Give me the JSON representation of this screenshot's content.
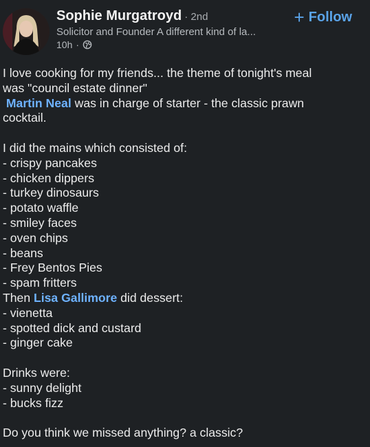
{
  "author": {
    "name": "Sophie Murgatroyd",
    "degree": "· 2nd",
    "headline": "Solicitor and Founder A different kind of la...",
    "time": "10h",
    "visibility_icon": "globe-icon"
  },
  "follow": {
    "label": "Follow",
    "icon": "plus-icon"
  },
  "post": {
    "line1": "I love cooking for my friends... the theme of tonight's meal",
    "line2": "was \"council estate dinner\"",
    "mention1": "Martin Neal",
    "line3_rest": " was in charge of starter - the classic prawn",
    "line4": "cocktail.",
    "mains_intro": "I did the mains which consisted of:",
    "mains": [
      "- crispy pancakes",
      "- chicken dippers",
      "- turkey dinosaurs",
      "- potato waffle",
      "- smiley faces",
      "- oven chips",
      "- beans",
      "- Frey Bentos Pies",
      "- spam fritters"
    ],
    "then": "Then ",
    "mention2": "Lisa Gallimore",
    "dessert_rest": " did dessert:",
    "desserts": [
      "- vienetta",
      "- spotted dick and custard",
      "- ginger cake"
    ],
    "drinks_intro": "Drinks were:",
    "drinks": [
      "- sunny delight",
      "- bucks fizz"
    ],
    "closing": "Do you think we missed anything? a classic?"
  },
  "colors": {
    "background": "#1e2124",
    "accent": "#5aa3e8",
    "mention": "#6eb2ff"
  }
}
